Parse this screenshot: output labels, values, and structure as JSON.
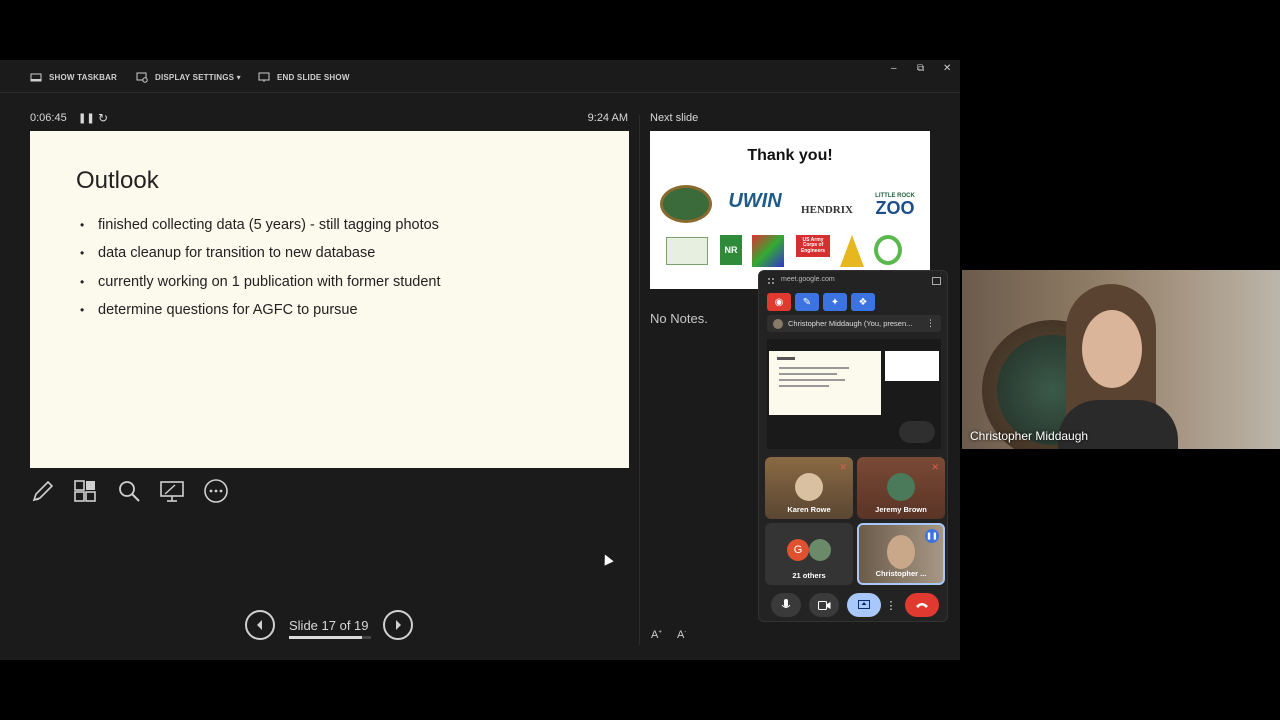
{
  "toolbar": {
    "show_taskbar": "SHOW TASKBAR",
    "display_settings": "DISPLAY SETTINGS ▾",
    "end_slide_show": "END SLIDE SHOW"
  },
  "window": {
    "minimize": "–",
    "restore": "⧉",
    "close": "✕"
  },
  "status": {
    "timer": "0:06:45",
    "clock": "9:24 AM"
  },
  "current_slide": {
    "title": "Outlook",
    "bullets": [
      "finished collecting data (5 years) - still tagging photos",
      "data cleanup for transition to new database",
      "currently working on 1 publication with former student",
      "determine questions for AGFC to pursue"
    ]
  },
  "next_slide": {
    "label": "Next slide",
    "title": "Thank you!",
    "logos": [
      "UWIN",
      "HENDRIX",
      "LITTLE ROCK",
      "ZOO",
      "NR",
      "US Army Corps of Engineers"
    ]
  },
  "notes": {
    "text": "No Notes."
  },
  "navigation": {
    "slide_counter": "Slide 17 of 19",
    "current": 17,
    "total": 19
  },
  "tools": [
    "pen-icon",
    "slides-grid-icon",
    "zoom-icon",
    "pointer-screen-icon",
    "more-icon"
  ],
  "meet": {
    "url": "meet.google.com",
    "presenting_bar": "Christopher Middaugh (You, presen...",
    "tiles": [
      {
        "name": "Karen Rowe"
      },
      {
        "name": "Jeremy Brown"
      },
      {
        "name": "21 others",
        "initial": "G"
      },
      {
        "name": "Christopher ..."
      }
    ]
  },
  "webcam": {
    "name": "Christopher Middaugh"
  },
  "colors": {
    "slide_bg": "#fcf9ed",
    "end_call": "#e0392f",
    "meet_blue": "#a8c7fa",
    "record_red": "#e0392f"
  }
}
